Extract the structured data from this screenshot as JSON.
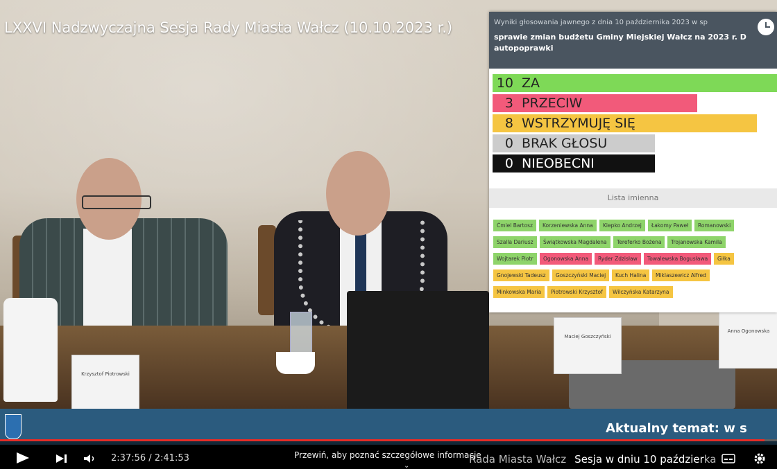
{
  "video": {
    "title": "LXXVI Nadzwyczajna Sesja Rady Miasta Wałcz (10.10.2023 r.)"
  },
  "vote_panel": {
    "header_small": "Wyniki głosowania jawnego z dnia 10 października 2023 w sp",
    "header_bold": "sprawie zmian budżetu Gminy Miejskiej Wałcz na 2023 r. D autopoprawki",
    "results": [
      {
        "count": "10",
        "label": "ZA",
        "color": "#7ed957",
        "fill": 1.0
      },
      {
        "count": "3",
        "label": "PRZECIW",
        "color": "#f25a7a",
        "fill": 0.72
      },
      {
        "count": "8",
        "label": "WSTRZYMUJĘ SIĘ",
        "color": "#f5c542",
        "fill": 0.93
      },
      {
        "count": "0",
        "label": "BRAK GŁOSU",
        "color": "#cccccc",
        "fill": 0.57
      },
      {
        "count": "0",
        "label": "NIEOBECNI",
        "color": "#111111",
        "text_color": "#ffffff",
        "fill": 0.57
      }
    ],
    "list_title": "Lista imienna",
    "names": [
      [
        "Ćmiel Bartosz",
        "Korzeniewska Anna",
        "Kiepko Andrzej",
        "Łakomy Paweł",
        "Romanowski"
      ],
      [
        "Szalla Dariusz",
        "Świątkowska Magdalena",
        "Tereferko Bożena",
        "Trojanowska Kamila"
      ],
      [
        "Wojtarek Piotr",
        "Ogonowska Anna",
        "Ryder Zdzisław",
        "Towalewska Bogusława",
        "Giłka"
      ],
      [
        "Gnojewski Tadeusz",
        "Goszczyński Maciej",
        "Kuch Halina",
        "Miklaszewicz Alfred"
      ],
      [
        "Minkowska Maria",
        "Piotrowski Krzysztof",
        "Wilczyńska Katarzyna"
      ]
    ],
    "name_colors": [
      [
        "#8ed46a",
        "#8ed46a",
        "#8ed46a",
        "#8ed46a",
        "#8ed46a"
      ],
      [
        "#8ed46a",
        "#8ed46a",
        "#8ed46a",
        "#8ed46a"
      ],
      [
        "#8ed46a",
        "#f25a7a",
        "#f25a7a",
        "#f25a7a",
        "#f5c542"
      ],
      [
        "#f5c542",
        "#f5c542",
        "#f5c542",
        "#f5c542"
      ],
      [
        "#f5c542",
        "#f5c542",
        "#f5c542"
      ]
    ]
  },
  "scene": {
    "nameplate_left": "Krzysztof Piotrowski",
    "nameplate_mid": "Maciej Goszczyński",
    "nameplate_right": "Anna Ogonowska"
  },
  "banner": {
    "topic_label": "Aktualny temat:",
    "topic_rest": " w s"
  },
  "player": {
    "time_display": "2:37:56 / 2:41:53",
    "progress_fraction": 0.984,
    "seek_hint": "Przewiń, aby poznać szczegółowe informacje",
    "ticker_left": "Rada Miasta Wałcz",
    "ticker_right": "Sesja w dniu 10 paździer",
    "ticker_tail": "ka"
  }
}
